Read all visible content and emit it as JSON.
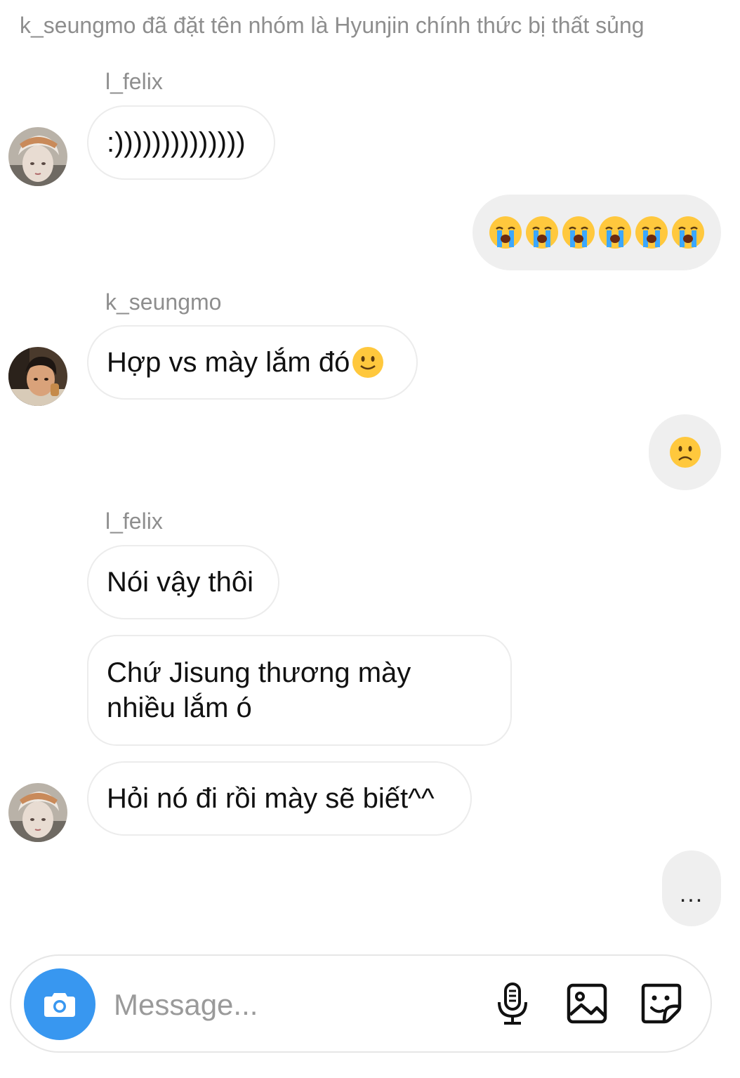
{
  "system_notice": "k_seungmo đã đặt tên nhóm là Hyunjin chính thức bị thất sủng",
  "messages": {
    "m1_sender": "l_felix",
    "m1_text": ":))))))))))))))",
    "m3_sender": "k_seungmo",
    "m3_text": "Hợp vs mày lắm đó",
    "m5_sender": "l_felix",
    "m5_text": "Nói vậy thôi",
    "m6_line1": "Chứ Jisung thương mày",
    "m6_line2": "nhiều lắm ó",
    "m7_text": "Hỏi nó đi rồi mày sẽ biết^^"
  },
  "outgoing": {
    "m2_emoji": "loudly-crying-face x6",
    "m4_emoji": "frowning-face",
    "m8_typing": "..."
  },
  "composer": {
    "placeholder": "Message..."
  },
  "colors": {
    "accent": "#3897f0",
    "outgoing_bubble": "#efefef",
    "incoming_border": "#ececec",
    "secondary_text": "#8e8e8e"
  }
}
